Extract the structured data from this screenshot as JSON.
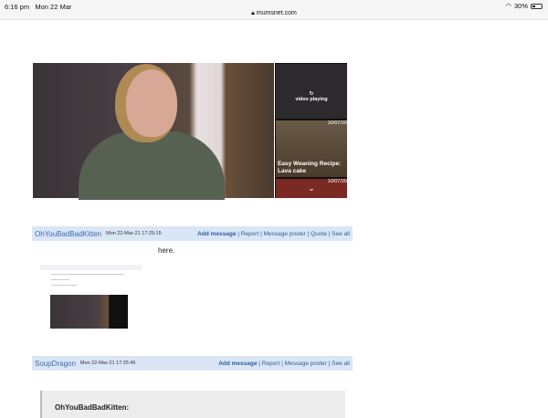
{
  "status_bar": {
    "time": "6:16 pm",
    "date": "Mon 22 Mar",
    "url": "mumsnet.com",
    "battery": "30%"
  },
  "video": {
    "sidebar": [
      {
        "status": "video playing"
      },
      {
        "date": "10/07/20",
        "caption_line1": "Easy Weaning Recipe:",
        "caption_line2": "Lava cake"
      },
      {
        "date": "10/07/20"
      }
    ]
  },
  "posts": [
    {
      "author": "OhYouBadBadKitten",
      "timestamp": "Mon 22-Mar-21 17:25:15",
      "add": "Add message",
      "links": " | Report | Message poster | Quote | See all",
      "body": "here."
    },
    {
      "author": "SoupDragon",
      "timestamp": "Mon 22-Mar-21 17:25:45",
      "add": "Add message",
      "links": " | Report | Message poster | See all",
      "quote_author": "OhYouBadBadKitten:"
    }
  ]
}
